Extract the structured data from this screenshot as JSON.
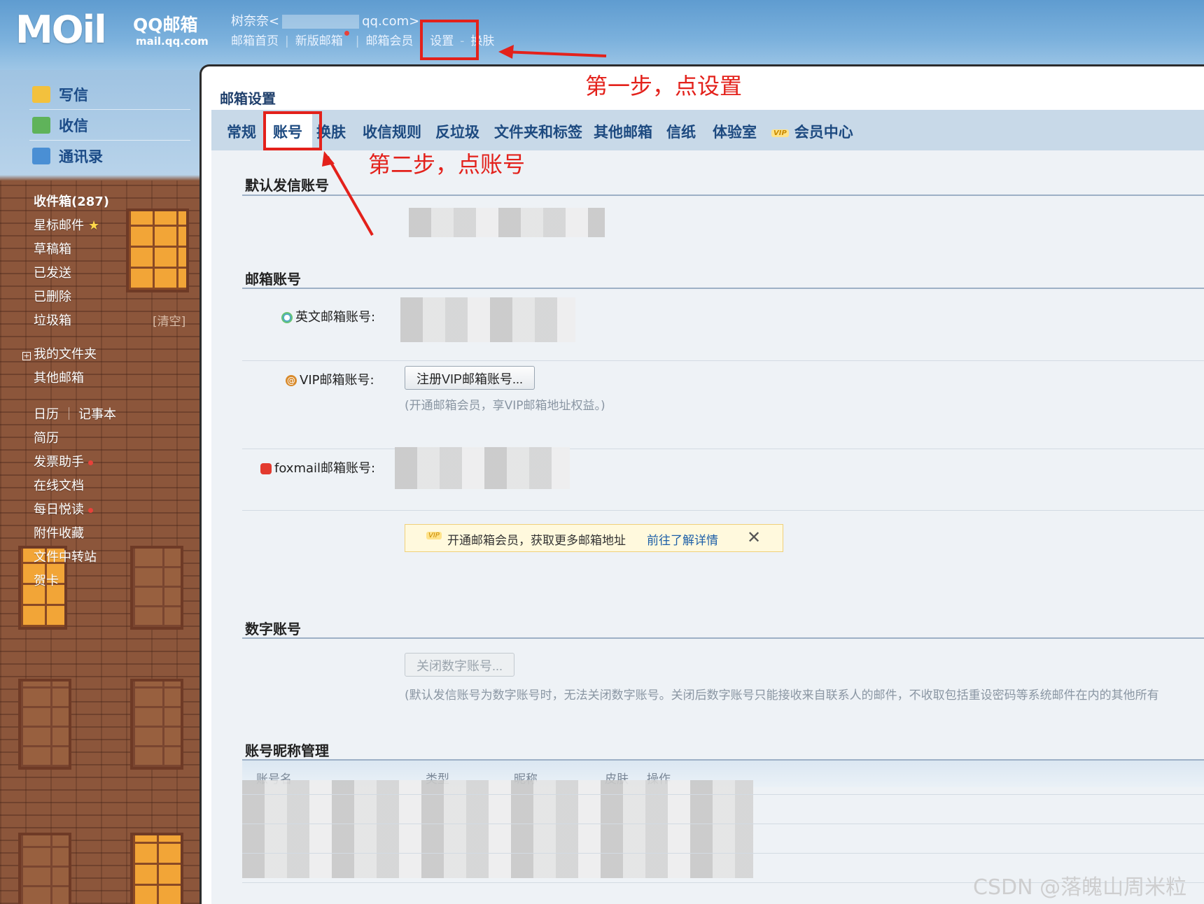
{
  "header": {
    "logo_text": "MOil",
    "brand": "QQ邮箱",
    "brand_domain": "mail.qq.com",
    "user_name": "树奈奈<",
    "user_email_suffix": "qq.com>",
    "nav": {
      "home": "邮箱首页",
      "new_version": "新版邮箱",
      "member": "邮箱会员",
      "settings": "设置",
      "skin": "换肤"
    }
  },
  "sidebar": {
    "quick": {
      "compose": "写信",
      "receive": "收信",
      "contacts": "通讯录"
    },
    "folders": {
      "inbox": "收件箱(287)",
      "starred": "星标邮件",
      "starred_mark": "★",
      "drafts": "草稿箱",
      "sent": "已发送",
      "deleted": "已删除",
      "trash": "垃圾箱",
      "trash_action": "[清空]",
      "my_folders": "我的文件夹",
      "other_mail": "其他邮箱",
      "calendar": "日历",
      "notes": "记事本",
      "resume": "简历",
      "invoice": "发票助手",
      "docs": "在线文档",
      "daily_read": "每日悦读",
      "attachments": "附件收藏",
      "transfer": "文件中转站",
      "cards": "贺卡"
    }
  },
  "main": {
    "title": "邮箱设置",
    "tabs": {
      "general": "常规",
      "account": "账号",
      "skin": "换肤",
      "rules": "收信规则",
      "antispam": "反垃圾",
      "folders_tags": "文件夹和标签",
      "other_mail": "其他邮箱",
      "stationery": "信纸",
      "lab": "体验室",
      "vip_badge": "VIP",
      "vip_center": "会员中心"
    },
    "sections": {
      "default_sender": "默认发信账号",
      "mail_account": "邮箱账号",
      "digital_account": "数字账号",
      "nickname_mgmt": "账号昵称管理"
    },
    "fields": {
      "english_account_label": "英文邮箱账号:",
      "vip_account_label": "VIP邮箱账号:",
      "vip_register_button": "注册VIP邮箱账号...",
      "vip_hint": "(开通邮箱会员，享VIP邮箱地址权益。)",
      "foxmail_label": "foxmail邮箱账号:",
      "close_digital_button": "关闭数字账号...",
      "digital_hint": "(默认发信账号为数字账号时，无法关闭数字账号。关闭后数字账号只能接收来自联系人的邮件，不收取包括重设密码等系统邮件在内的其他所有"
    },
    "promo": {
      "badge": "VIP",
      "text": "开通邮箱会员，获取更多邮箱地址",
      "link": "前往了解详情",
      "close": "✕"
    },
    "table_headers": {
      "name": "账号名",
      "type": "类型",
      "nickname": "昵称",
      "skin": "皮肤",
      "action": "操作"
    }
  },
  "annotations": {
    "step1": "第一步，点设置",
    "step2": "第二步，点账号",
    "color": "#e3211b"
  },
  "watermark": "CSDN @落魄山周米粒"
}
